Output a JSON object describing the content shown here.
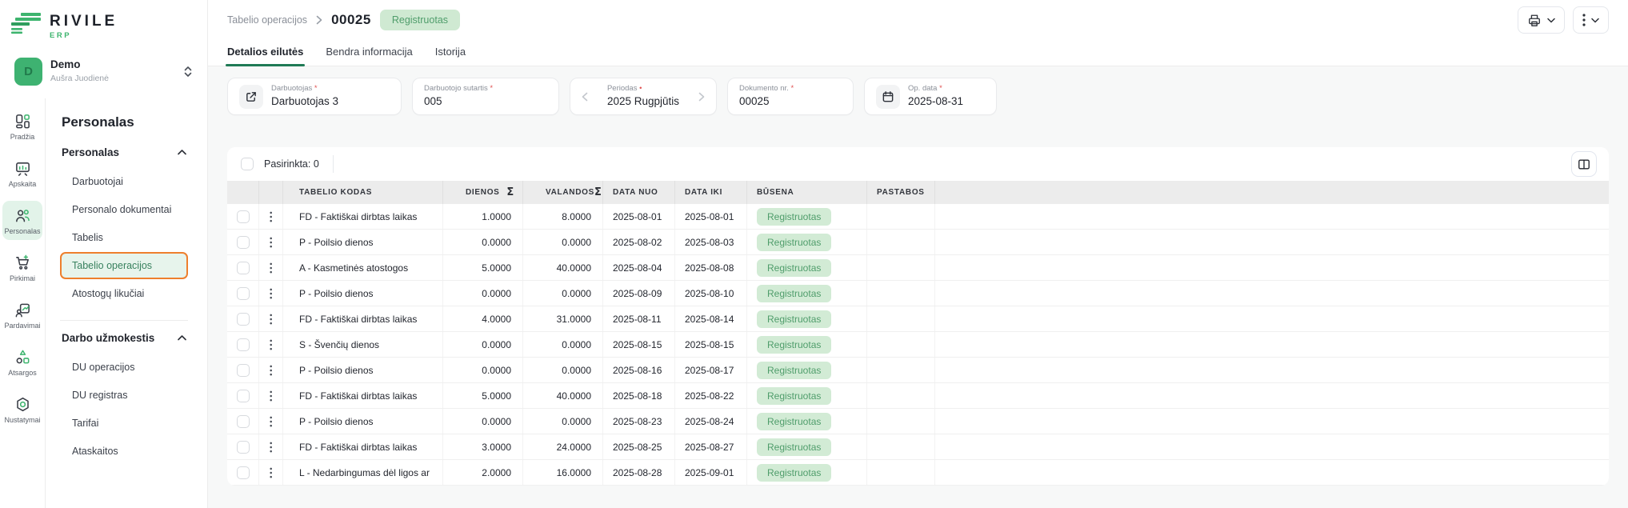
{
  "brand": {
    "name": "RIVILE",
    "suffix": "ERP"
  },
  "user": {
    "initial": "D",
    "workspace": "Demo",
    "name": "Aušra Juodienė"
  },
  "rail": {
    "items": [
      {
        "label": "Pradžia"
      },
      {
        "label": "Apskaita"
      },
      {
        "label": "Personalas"
      },
      {
        "label": "Pirkimai"
      },
      {
        "label": "Pardavimai"
      },
      {
        "label": "Atsargos"
      },
      {
        "label": "Nustatymai"
      }
    ]
  },
  "sidebar": {
    "title": "Personalas",
    "sections": [
      {
        "label": "Personalas",
        "items": [
          {
            "label": "Darbuotojai"
          },
          {
            "label": "Personalo dokumentai"
          },
          {
            "label": "Tabelis"
          },
          {
            "label": "Tabelio operacijos"
          },
          {
            "label": "Atostogų likučiai"
          }
        ]
      },
      {
        "label": "Darbo užmokestis",
        "items": [
          {
            "label": "DU operacijos"
          },
          {
            "label": "DU registras"
          },
          {
            "label": "Tarifai"
          },
          {
            "label": "Ataskaitos"
          }
        ]
      }
    ]
  },
  "header": {
    "breadcrumb": "Tabelio operacijos",
    "doc_number": "00025",
    "status": "Registruotas",
    "tabs": [
      {
        "label": "Detalios eilutės"
      },
      {
        "label": "Bendra informacija"
      },
      {
        "label": "Istorija"
      }
    ]
  },
  "form": {
    "fields": [
      {
        "label": "Darbuotojas",
        "required": "*",
        "value": "Darbuotojas 3",
        "icon": "external-link-icon"
      },
      {
        "label": "Darbuotojo sutartis",
        "required": "*",
        "value": "005"
      },
      {
        "label": "Periodas",
        "required": "•",
        "value": "2025 Rugpjūtis",
        "prev": "‹",
        "next": "›"
      },
      {
        "label": "Dokumento nr.",
        "required": "*",
        "value": "00025"
      },
      {
        "label": "Op. data",
        "required": "*",
        "value": "2025-08-31",
        "icon": "calendar-icon"
      }
    ]
  },
  "table": {
    "selected_label": "Pasirinkta: 0",
    "sigma": "Σ",
    "columns": {
      "code": "TABELIO KODAS",
      "days": "DIENOS",
      "hours": "VALANDOS",
      "from": "DATA NUO",
      "to": "DATA IKI",
      "status": "BŪSENA",
      "notes": "PASTABOS"
    },
    "rows": [
      {
        "code": "FD - Faktiškai dirbtas laikas",
        "days": "1.0000",
        "hours": "8.0000",
        "from": "2025-08-01",
        "to": "2025-08-01",
        "status": "Registruotas",
        "notes": ""
      },
      {
        "code": "P - Poilsio dienos",
        "days": "0.0000",
        "hours": "0.0000",
        "from": "2025-08-02",
        "to": "2025-08-03",
        "status": "Registruotas",
        "notes": ""
      },
      {
        "code": "A - Kasmetinės atostogos",
        "days": "5.0000",
        "hours": "40.0000",
        "from": "2025-08-04",
        "to": "2025-08-08",
        "status": "Registruotas",
        "notes": ""
      },
      {
        "code": "P - Poilsio dienos",
        "days": "0.0000",
        "hours": "0.0000",
        "from": "2025-08-09",
        "to": "2025-08-10",
        "status": "Registruotas",
        "notes": ""
      },
      {
        "code": "FD - Faktiškai dirbtas laikas",
        "days": "4.0000",
        "hours": "31.0000",
        "from": "2025-08-11",
        "to": "2025-08-14",
        "status": "Registruotas",
        "notes": ""
      },
      {
        "code": "S - Švenčių dienos",
        "days": "0.0000",
        "hours": "0.0000",
        "from": "2025-08-15",
        "to": "2025-08-15",
        "status": "Registruotas",
        "notes": ""
      },
      {
        "code": "P - Poilsio dienos",
        "days": "0.0000",
        "hours": "0.0000",
        "from": "2025-08-16",
        "to": "2025-08-17",
        "status": "Registruotas",
        "notes": ""
      },
      {
        "code": "FD - Faktiškai dirbtas laikas",
        "days": "5.0000",
        "hours": "40.0000",
        "from": "2025-08-18",
        "to": "2025-08-22",
        "status": "Registruotas",
        "notes": ""
      },
      {
        "code": "P - Poilsio dienos",
        "days": "0.0000",
        "hours": "0.0000",
        "from": "2025-08-23",
        "to": "2025-08-24",
        "status": "Registruotas",
        "notes": ""
      },
      {
        "code": "FD - Faktiškai dirbtas laikas",
        "days": "3.0000",
        "hours": "24.0000",
        "from": "2025-08-25",
        "to": "2025-08-27",
        "status": "Registruotas",
        "notes": ""
      },
      {
        "code": "L - Nedarbingumas dėl ligos ar",
        "days": "2.0000",
        "hours": "16.0000",
        "from": "2025-08-28",
        "to": "2025-09-01",
        "status": "Registruotas",
        "notes": ""
      }
    ]
  },
  "colors": {
    "accent_green": "#3db46e",
    "deep_green": "#1f7a55",
    "badge_bg": "#d2ebd5",
    "badge_text": "#4f9d6b",
    "highlight_orange": "#ee7f2d"
  }
}
